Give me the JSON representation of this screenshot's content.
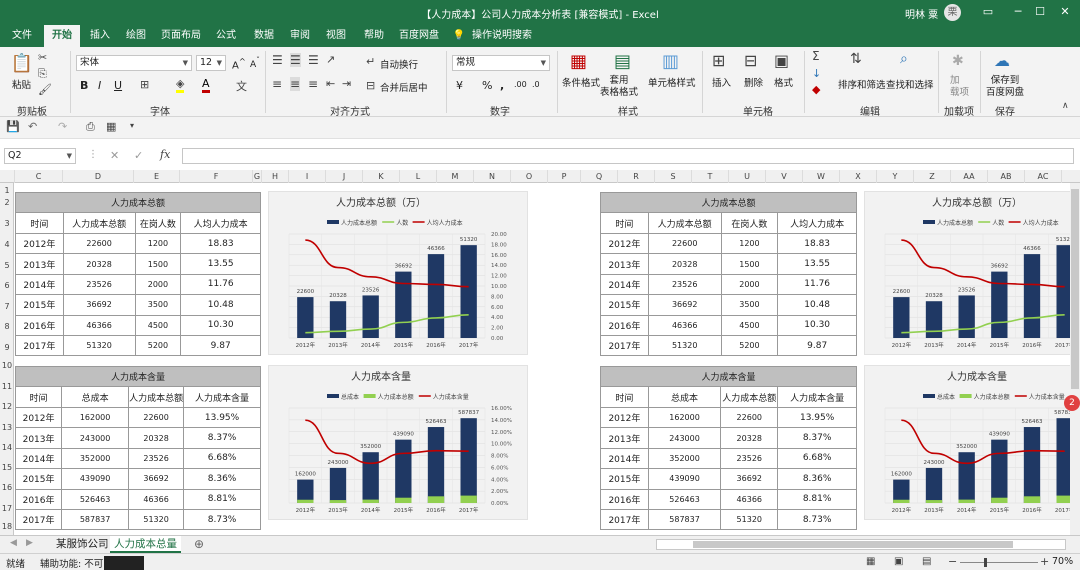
{
  "window": {
    "title": "【人力成本】公司人力成本分析表 [兼容模式] - Excel",
    "user": "明林 粟",
    "avatar_letter": "栗"
  },
  "menu": {
    "tabs": [
      "文件",
      "开始",
      "插入",
      "绘图",
      "页面布局",
      "公式",
      "数据",
      "审阅",
      "视图",
      "帮助",
      "百度网盘"
    ],
    "active": "开始",
    "tell_me": "操作说明搜索"
  },
  "ribbon": {
    "clipboard": {
      "paste": "粘贴",
      "label": "剪贴板"
    },
    "font": {
      "name": "宋体",
      "size": "12",
      "label": "字体",
      "bold": "B",
      "italic": "I",
      "underline": "U"
    },
    "alignment": {
      "wrap": "自动换行",
      "merge": "合并后居中",
      "label": "对齐方式"
    },
    "number": {
      "format": "常规",
      "label": "数字"
    },
    "styles": {
      "cond": "条件格式",
      "table": "套用\n表格格式",
      "cell": "单元格样式",
      "label": "样式"
    },
    "cells": {
      "insert": "插入",
      "delete": "删除",
      "format": "格式",
      "label": "单元格"
    },
    "editing": {
      "sort": "排序和筛选",
      "find": "查找和选择",
      "label": "编辑"
    },
    "addins": {
      "load": "加\n载项",
      "label": "加载项"
    },
    "save": {
      "baidu": "保存到\n百度网盘",
      "label": "保存"
    }
  },
  "formula": {
    "cell_ref": "Q2",
    "fx": "fx",
    "value": ""
  },
  "columns": [
    "C",
    "D",
    "E",
    "F",
    "G",
    "H",
    "I",
    "J",
    "K",
    "L",
    "M",
    "N",
    "O",
    "P",
    "Q",
    "R",
    "S",
    "T",
    "U",
    "V",
    "W",
    "X",
    "Y",
    "Z",
    "AA",
    "AB",
    "AC"
  ],
  "rows": [
    "1",
    "2",
    "3",
    "4",
    "5",
    "6",
    "7",
    "8",
    "9",
    "10",
    "11",
    "12",
    "13",
    "14",
    "15",
    "16",
    "17",
    "18"
  ],
  "table1": {
    "title": "人力成本总额",
    "headers": [
      "时间",
      "人力成本总额",
      "在岗人数",
      "人均人力成本"
    ],
    "rows": [
      [
        "2012年",
        "22600",
        "1200",
        "18.83"
      ],
      [
        "2013年",
        "20328",
        "1500",
        "13.55"
      ],
      [
        "2014年",
        "23526",
        "2000",
        "11.76"
      ],
      [
        "2015年",
        "36692",
        "3500",
        "10.48"
      ],
      [
        "2016年",
        "46366",
        "4500",
        "10.30"
      ],
      [
        "2017年",
        "51320",
        "5200",
        "9.87"
      ]
    ]
  },
  "table2": {
    "title": "人力成本含量",
    "headers": [
      "时间",
      "总成本",
      "人力成本总额",
      "人力成本含量"
    ],
    "rows": [
      [
        "2012年",
        "162000",
        "22600",
        "13.95%"
      ],
      [
        "2013年",
        "243000",
        "20328",
        "8.37%"
      ],
      [
        "2014年",
        "352000",
        "23526",
        "6.68%"
      ],
      [
        "2015年",
        "439090",
        "36692",
        "8.36%"
      ],
      [
        "2016年",
        "526463",
        "46366",
        "8.81%"
      ],
      [
        "2017年",
        "587837",
        "51320",
        "8.73%"
      ]
    ]
  },
  "chart_data": [
    {
      "type": "bar",
      "title": "人力成本总额（万）",
      "categories": [
        "2012年",
        "2013年",
        "2014年",
        "2015年",
        "2016年",
        "2017年"
      ],
      "series": [
        {
          "name": "人力成本总额",
          "kind": "bar",
          "axis": "left",
          "values": [
            22600,
            20328,
            23526,
            36692,
            46366,
            51320
          ],
          "color": "#1f3864"
        },
        {
          "name": "人数",
          "kind": "line",
          "axis": "right",
          "values": [
            1200,
            1500,
            2000,
            3500,
            4500,
            5200
          ],
          "color": "#92d050"
        },
        {
          "name": "人均人力成本",
          "kind": "line",
          "axis": "right",
          "values": [
            18.83,
            13.55,
            11.76,
            10.48,
            10.3,
            9.87
          ],
          "color": "#c00000"
        }
      ],
      "y2ticks": [
        "20.00",
        "18.00",
        "16.00",
        "14.00",
        "12.00",
        "10.00",
        "8.00",
        "6.00",
        "4.00",
        "2.00",
        "0.00"
      ],
      "y2lim": [
        0,
        20
      ]
    },
    {
      "type": "bar",
      "title": "人力成本含量",
      "categories": [
        "2012年",
        "2013年",
        "2014年",
        "2015年",
        "2016年",
        "2017年"
      ],
      "series": [
        {
          "name": "总成本",
          "kind": "bar",
          "axis": "left",
          "values": [
            162000,
            243000,
            352000,
            439090,
            526463,
            587837
          ],
          "color": "#1f3864"
        },
        {
          "name": "人力成本总额",
          "kind": "bar",
          "axis": "left",
          "values": [
            22600,
            20328,
            23526,
            36692,
            46366,
            51320
          ],
          "color": "#92d050"
        },
        {
          "name": "人力成本含量",
          "kind": "line",
          "axis": "right",
          "values": [
            13.95,
            8.37,
            6.68,
            8.36,
            8.81,
            8.73
          ],
          "color": "#c00000"
        }
      ],
      "y2ticks": [
        "16.00%",
        "14.00%",
        "12.00%",
        "10.00%",
        "8.00%",
        "6.00%",
        "4.00%",
        "2.00%",
        "0.00%"
      ],
      "y2lim": [
        0,
        16
      ]
    }
  ],
  "sheets": {
    "tabs": [
      "某服饰公司",
      "人力成本总量"
    ],
    "active": "人力成本总量"
  },
  "status": {
    "ready": "就绪",
    "accessibility": "辅助功能: 不可",
    "zoom": "70%",
    "badge": "2"
  }
}
